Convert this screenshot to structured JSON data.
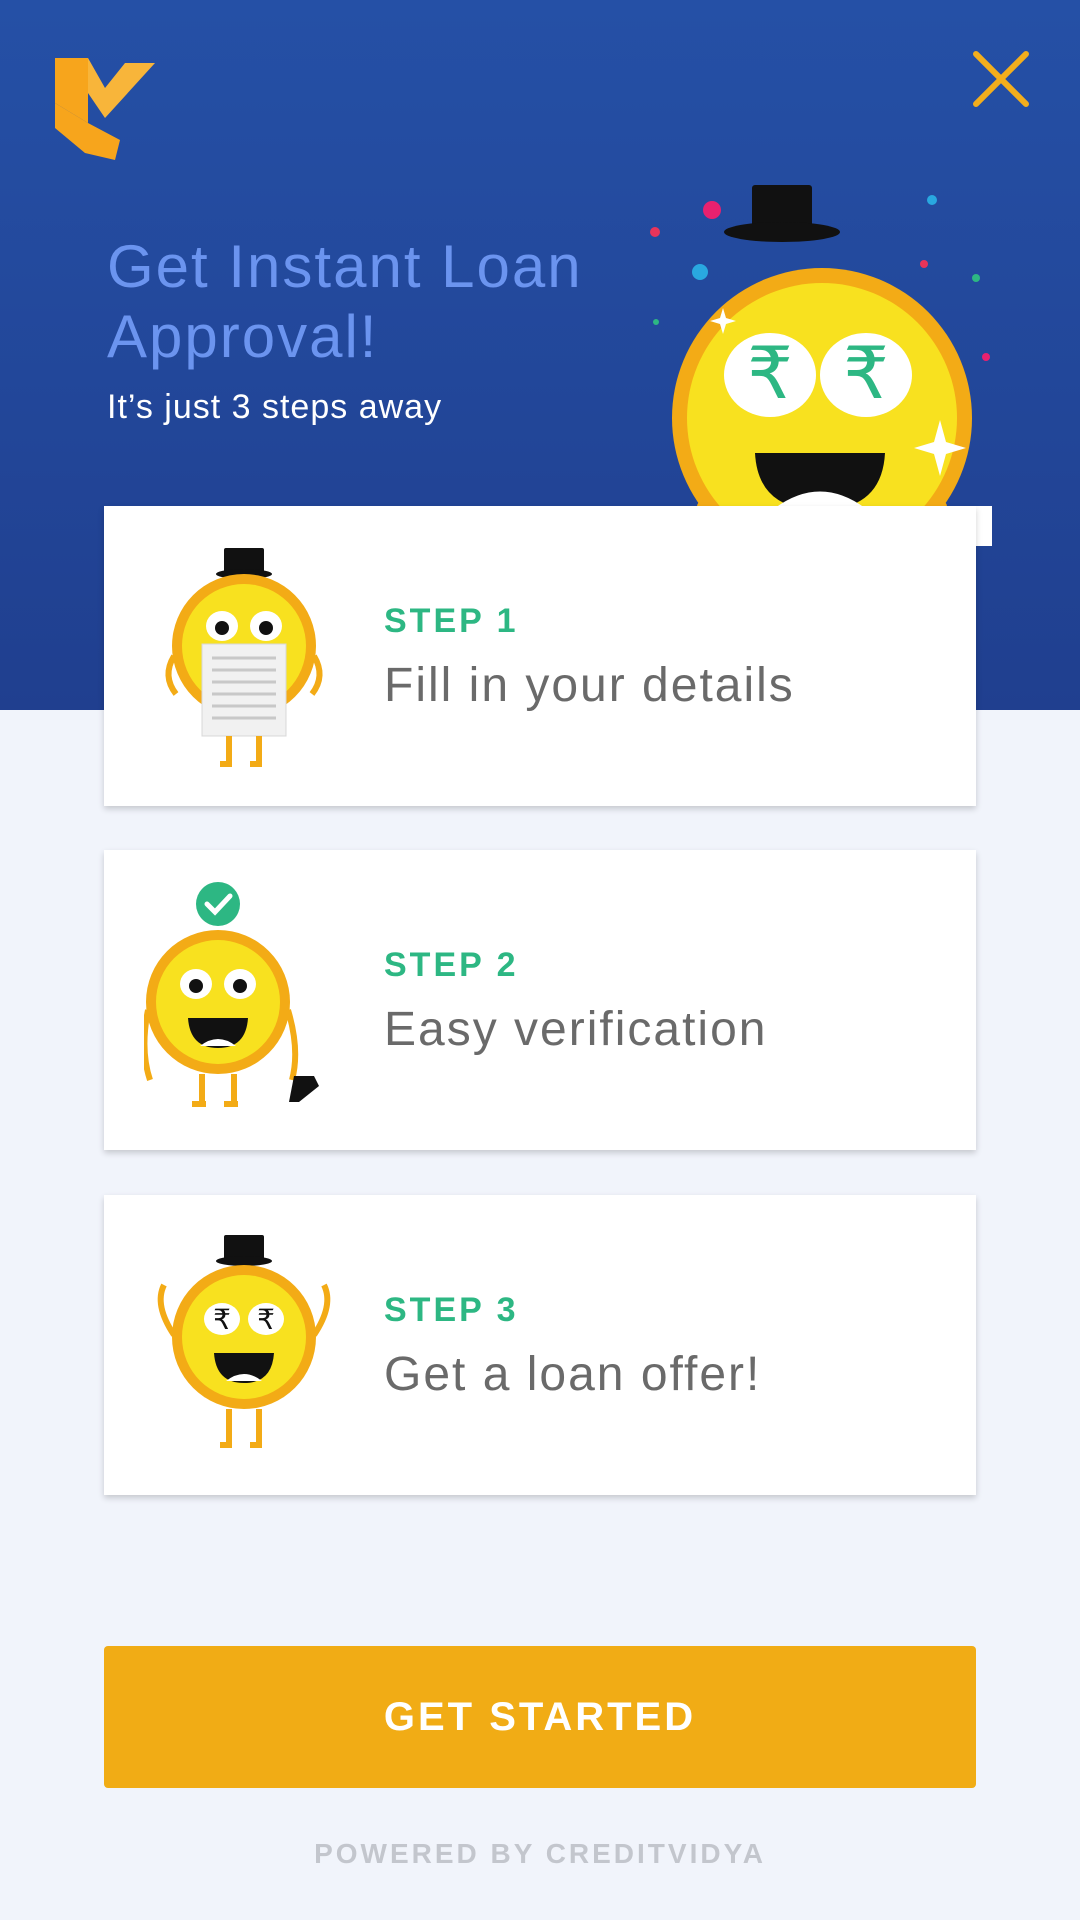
{
  "header": {
    "logo_icon": "creditvidya-logo-icon",
    "close_icon": "close-icon",
    "title": "Get Instant Loan Approval!",
    "subtitle": "It’s just 3 steps away",
    "mascot": "coin-mascot-top-hat-icon"
  },
  "steps": [
    {
      "label": "STEP 1",
      "description": "Fill in your details",
      "icon": "coin-mascot-holding-document-icon"
    },
    {
      "label": "STEP 2",
      "description": "Easy verification",
      "icon": "coin-mascot-verified-icon"
    },
    {
      "label": "STEP 3",
      "description": "Get a loan offer!",
      "icon": "coin-mascot-rupee-eyes-icon"
    }
  ],
  "cta": {
    "label": "GET STARTED"
  },
  "footer": {
    "text": "POWERED BY CREDITVIDYA"
  },
  "colors": {
    "header_bg": "#2550a6",
    "accent": "#f1ac15",
    "step_green": "#2db783",
    "title_blue": "#6b94ef",
    "page_bg": "#f1f4fb"
  }
}
